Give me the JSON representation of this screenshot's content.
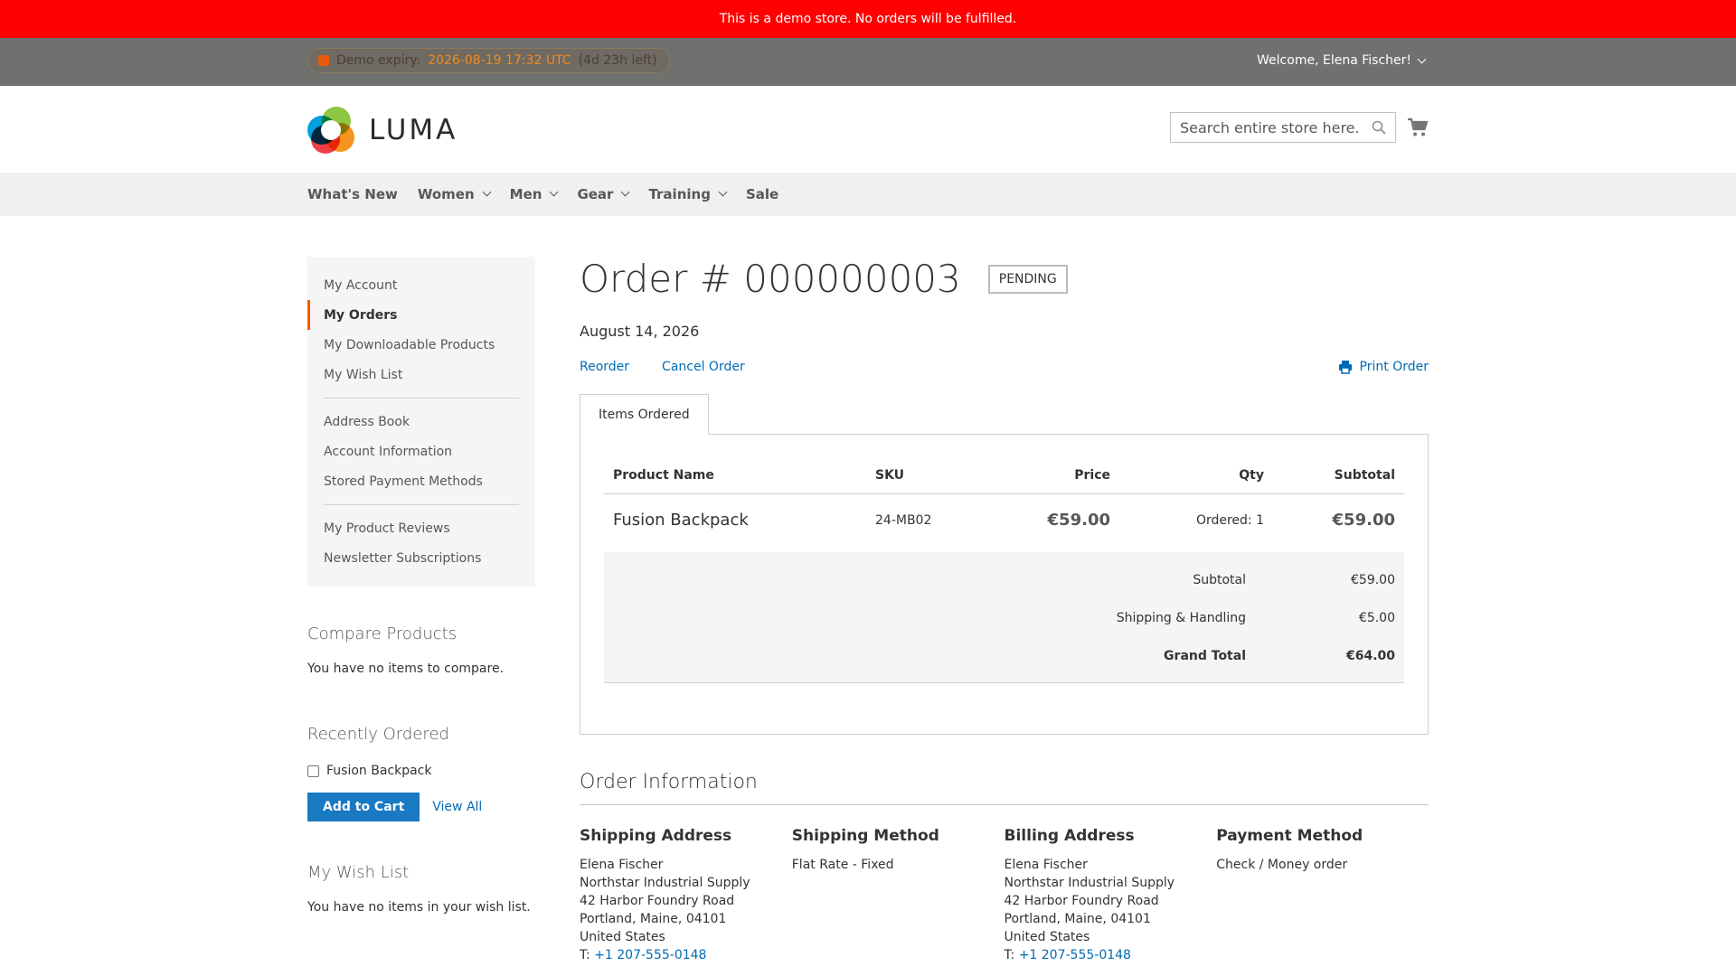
{
  "demo_notice": "This is a demo store. No orders will be fulfilled.",
  "header_panel": {
    "expiry_label": "Demo expiry:",
    "expiry_date": "2026-08-19 17:32 UTC",
    "expiry_left": "(4d 23h left)",
    "welcome": "Welcome, Elena Fischer!"
  },
  "brand": {
    "name": "LUMA"
  },
  "search": {
    "placeholder": "Search entire store here..."
  },
  "nav": [
    "What's New",
    "Women",
    "Men",
    "Gear",
    "Training",
    "Sale"
  ],
  "account_nav": {
    "group1": [
      "My Account",
      "My Orders",
      "My Downloadable Products",
      "My Wish List"
    ],
    "group2": [
      "Address Book",
      "Account Information",
      "Stored Payment Methods"
    ],
    "group3": [
      "My Product Reviews",
      "Newsletter Subscriptions"
    ]
  },
  "compare": {
    "title": "Compare Products",
    "empty": "You have no items to compare."
  },
  "recently_ordered": {
    "title": "Recently Ordered",
    "item": "Fusion Backpack",
    "add_to_cart": "Add to Cart",
    "view_all": "View All"
  },
  "wishlist": {
    "title": "My Wish List",
    "empty": "You have no items in your wish list."
  },
  "order": {
    "title": "Order # 000000003",
    "status": "PENDING",
    "date": "August 14, 2026",
    "reorder": "Reorder",
    "cancel": "Cancel Order",
    "print": "Print Order",
    "tab": "Items Ordered",
    "columns": {
      "name": "Product Name",
      "sku": "SKU",
      "price": "Price",
      "qty": "Qty",
      "subtotal": "Subtotal"
    },
    "item": {
      "name": "Fusion Backpack",
      "sku": "24-MB02",
      "price": "€59.00",
      "qty": "Ordered: 1",
      "subtotal": "€59.00"
    },
    "totals": {
      "subtotal_label": "Subtotal",
      "subtotal": "€59.00",
      "shipping_label": "Shipping & Handling",
      "shipping": "€5.00",
      "grand_label": "Grand Total",
      "grand": "€64.00"
    }
  },
  "order_info": {
    "title": "Order Information",
    "shipping_address": {
      "title": "Shipping Address",
      "lines": [
        "Elena Fischer",
        "Northstar Industrial Supply",
        "42 Harbor Foundry Road",
        "Portland, Maine, 04101",
        "United States"
      ],
      "tel_prefix": "T:",
      "tel": "+1 207-555-0148"
    },
    "shipping_method": {
      "title": "Shipping Method",
      "value": "Flat Rate - Fixed"
    },
    "billing_address": {
      "title": "Billing Address",
      "lines": [
        "Elena Fischer",
        "Northstar Industrial Supply",
        "42 Harbor Foundry Road",
        "Portland, Maine, 04101",
        "United States"
      ],
      "tel_prefix": "T:",
      "tel": "+1 207-555-0148"
    },
    "payment_method": {
      "title": "Payment Method",
      "value": "Check / Money order"
    }
  },
  "colors": {
    "demo_bar": "#ff0000",
    "link": "#006bb4",
    "primary_button": "#1979c3",
    "active_marker": "#ff5501"
  }
}
